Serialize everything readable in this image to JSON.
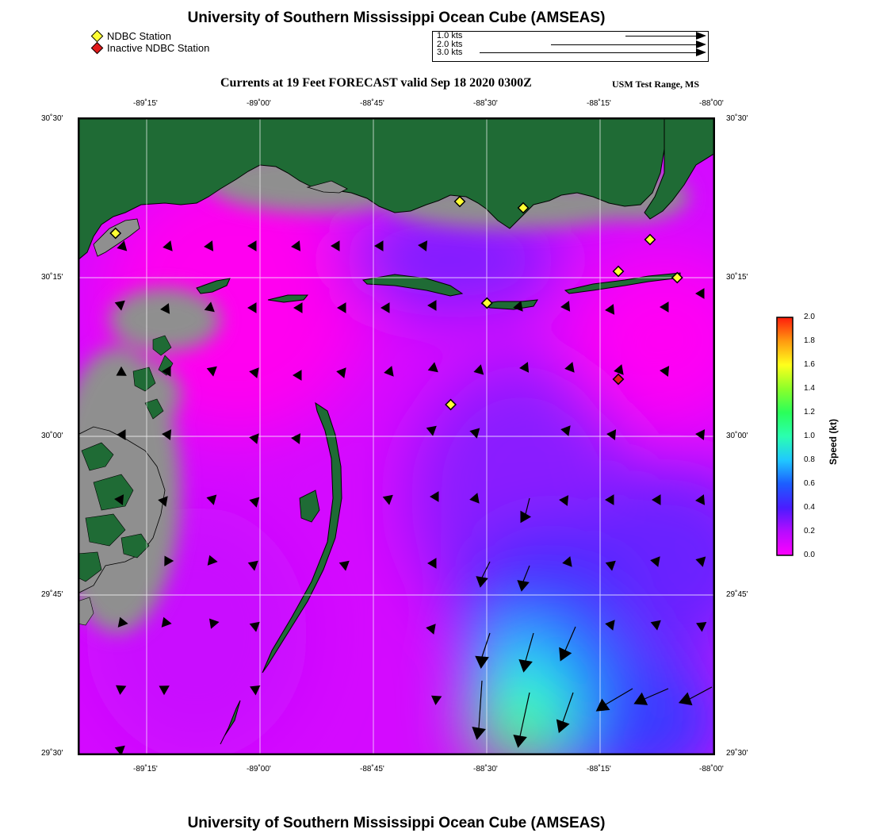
{
  "header": {
    "title": "University of Southern Mississippi Ocean Cube (AMSEAS)",
    "subtitle": "Currents at 19 Feet FORECAST valid Sep 18 2020 0300Z",
    "region": "USM Test Range, MS",
    "footer_title": "University of Southern Mississippi Ocean Cube (AMSEAS)"
  },
  "legend": {
    "active_station": "NDBC Station",
    "inactive_station": "Inactive NDBC Station",
    "active_color": "#ffff33",
    "inactive_color": "#e11a1a"
  },
  "vector_scale": [
    {
      "label": "1.0 kts",
      "knots": 1.0
    },
    {
      "label": "2.0 kts",
      "knots": 2.0
    },
    {
      "label": "3.0 kts",
      "knots": 3.0
    }
  ],
  "axes": {
    "top_lon_ticks": [
      "-89˚15'",
      "-89˚00'",
      "-88˚45'",
      "-88˚30'",
      "-88˚15'",
      "-88˚00'"
    ],
    "bottom_lon_ticks": [
      "-89˚15'",
      "-89˚00'",
      "-88˚45'",
      "-88˚30'",
      "-88˚15'",
      "-88˚00'"
    ],
    "left_lat_ticks": [
      "30˚30'",
      "30˚15'",
      "30˚00'",
      "29˚45'",
      "29˚30'"
    ],
    "right_lat_ticks": [
      "30˚30'",
      "30˚15'",
      "30˚00'",
      "29˚45'",
      "29˚30'"
    ],
    "lon_range": [
      -89.4,
      -88.0
    ],
    "lat_range": [
      29.5,
      30.5
    ]
  },
  "colorbar": {
    "label": "Speed (kt)",
    "ticks": [
      "2.0",
      "1.8",
      "1.6",
      "1.4",
      "1.2",
      "1.0",
      "0.8",
      "0.6",
      "0.4",
      "0.2",
      "0.0"
    ],
    "range": [
      0.0,
      2.0
    ]
  },
  "stations": [
    {
      "lon": -89.32,
      "lat": 30.32,
      "active": true
    },
    {
      "lon": -88.56,
      "lat": 30.37,
      "active": true
    },
    {
      "lon": -88.42,
      "lat": 30.36,
      "active": true
    },
    {
      "lon": -88.21,
      "lat": 30.26,
      "active": true
    },
    {
      "lon": -88.14,
      "lat": 30.31,
      "active": true
    },
    {
      "lon": -88.08,
      "lat": 30.25,
      "active": true
    },
    {
      "lon": -88.5,
      "lat": 30.21,
      "active": true
    },
    {
      "lon": -88.58,
      "lat": 30.05,
      "active": true
    },
    {
      "lon": -88.21,
      "lat": 30.09,
      "active": false
    }
  ],
  "colors": {
    "land": "#1f6b35",
    "land_gray": "#8c8c8c",
    "slow_water": "#ff00ff",
    "mid_water": "#5b2cff",
    "fast_water": "#2fffd0"
  }
}
